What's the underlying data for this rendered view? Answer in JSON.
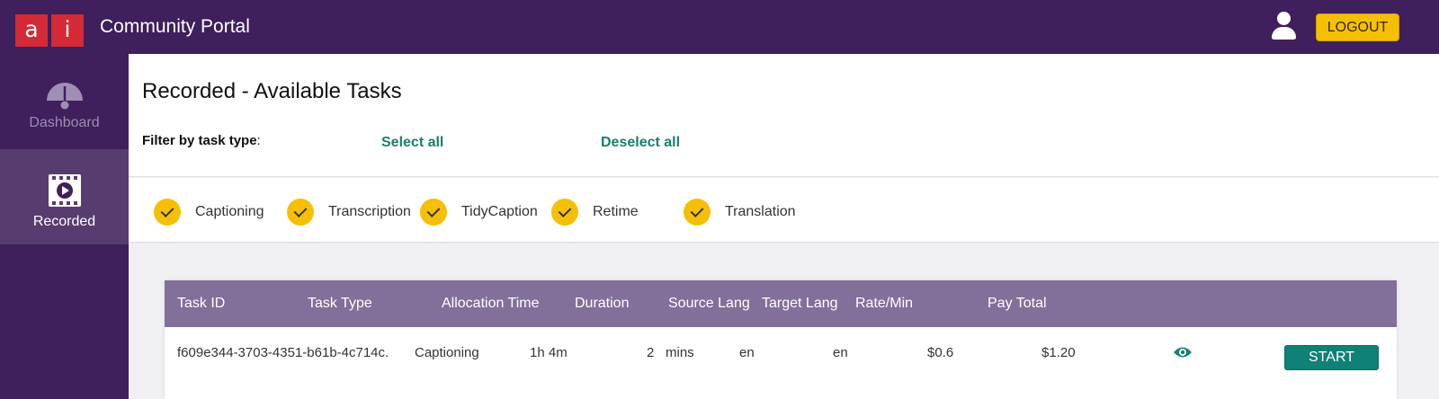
{
  "header": {
    "logo_letters": [
      "a",
      "i"
    ],
    "app_title": "Community Portal",
    "logout_label": "LOGOUT",
    "colors": {
      "bar": "#3f1f5c",
      "logo": "#d42a35",
      "logout": "#f5c004"
    }
  },
  "sidebar": {
    "items": [
      {
        "label": "Dashboard",
        "icon": "gauge-icon",
        "active": false
      },
      {
        "label": "Recorded",
        "icon": "film-play-icon",
        "active": true
      }
    ]
  },
  "page": {
    "title": "Recorded - Available Tasks",
    "filter_label": "Filter by task type",
    "filter_colon": ":",
    "select_all": "Select all",
    "deselect_all": "Deselect all"
  },
  "filters": [
    {
      "label": "Captioning",
      "checked": true
    },
    {
      "label": "Transcription",
      "checked": true
    },
    {
      "label": "TidyCaption",
      "checked": true
    },
    {
      "label": "Retime",
      "checked": true
    },
    {
      "label": "Translation",
      "checked": true
    }
  ],
  "table": {
    "columns": [
      "Task ID",
      "Task Type",
      "Allocation Time",
      "Duration",
      "Source Lang",
      "Target Lang",
      "Rate/Min",
      "Pay Total"
    ],
    "rows": [
      {
        "task_id": "f609e344-3703-4351-b61b-4c714c.",
        "task_type": "Captioning",
        "allocation_time": "1h 4m",
        "duration_value": "2",
        "duration_unit": "mins",
        "source_lang": "en",
        "target_lang": "en",
        "rate": "$0.6",
        "pay_total": "$1.20",
        "view_icon": "eye-icon",
        "action_label": "START"
      }
    ],
    "colors": {
      "header": "#81709a",
      "accent": "#0f8176"
    }
  }
}
